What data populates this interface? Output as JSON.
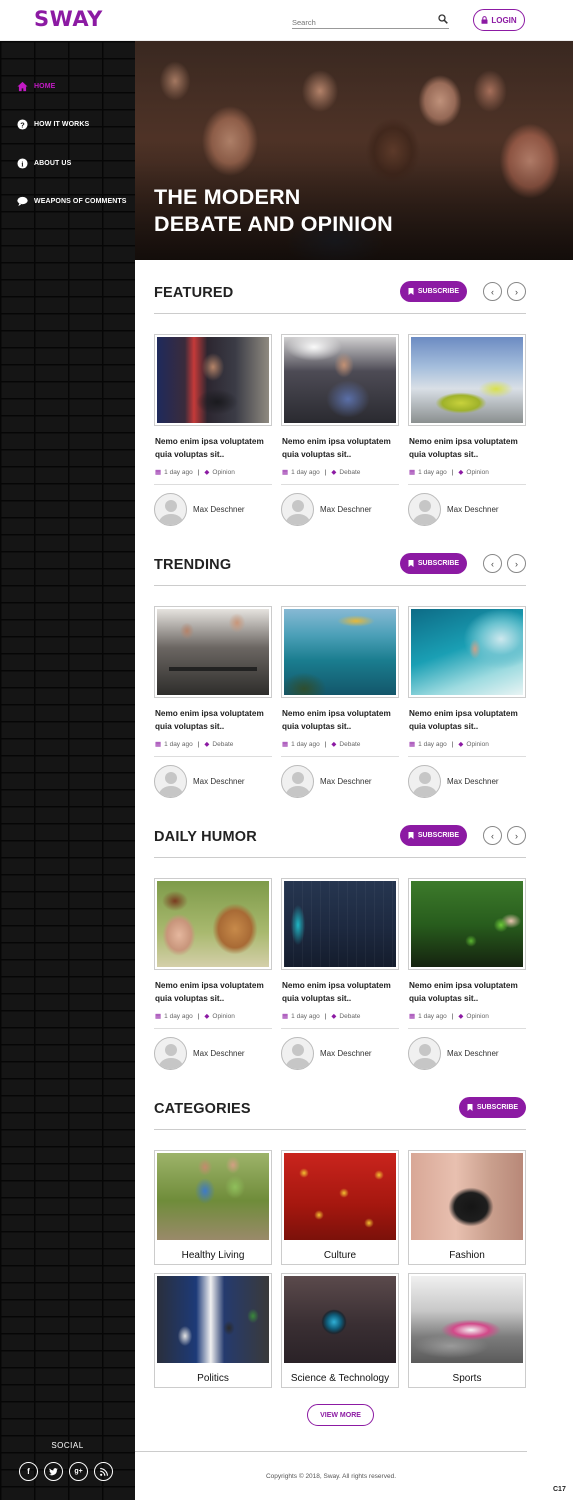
{
  "header": {
    "logo": "SWAY",
    "search_placeholder": "Search",
    "login_label": "LOGIN"
  },
  "sidebar": {
    "items": [
      {
        "label": "HOME",
        "icon": "home-icon"
      },
      {
        "label": "HOW IT WORKS",
        "icon": "question-circle-icon"
      },
      {
        "label": "ABOUT US",
        "icon": "info-circle-icon"
      },
      {
        "label": "WEAPONS OF COMMENTS",
        "icon": "comment-icon"
      }
    ],
    "social_title": "SOCIAL",
    "social": [
      "facebook-icon",
      "twitter-icon",
      "google-plus-icon",
      "rss-icon"
    ]
  },
  "hero": {
    "title_line1": "THE MODERN",
    "title_line2": "DEBATE AND OPINION"
  },
  "sections": [
    {
      "title": "FEATURED",
      "subscribe": "SUBSCRIBE",
      "cards": [
        {
          "title_line1": "Nemo enim ipsa voluptatem",
          "title_line2": "quia voluptas sit..",
          "time": "1 day ago",
          "tag": "Opinion",
          "author": "Max Deschner"
        },
        {
          "title_line1": "Nemo enim ipsa voluptatem",
          "title_line2": "quia voluptas sit..",
          "time": "1 day ago",
          "tag": "Debate",
          "author": "Max Deschner"
        },
        {
          "title_line1": "Nemo enim ipsa voluptatem",
          "title_line2": "quia voluptas sit..",
          "time": "1 day ago",
          "tag": "Opinion",
          "author": "Max Deschner"
        }
      ]
    },
    {
      "title": "TRENDING",
      "subscribe": "SUBSCRIBE",
      "cards": [
        {
          "title_line1": "Nemo enim ipsa voluptatem",
          "title_line2": "quia voluptas sit..",
          "time": "1 day ago",
          "tag": "Debate",
          "author": "Max Deschner"
        },
        {
          "title_line1": "Nemo enim ipsa voluptatem",
          "title_line2": "quia voluptas sit..",
          "time": "1 day ago",
          "tag": "Debate",
          "author": "Max Deschner"
        },
        {
          "title_line1": "Nemo enim ipsa voluptatem",
          "title_line2": "quia voluptas sit..",
          "time": "1 day ago",
          "tag": "Opinion",
          "author": "Max Deschner"
        }
      ]
    },
    {
      "title": "DAILY HUMOR",
      "subscribe": "SUBSCRIBE",
      "cards": [
        {
          "title_line1": "Nemo enim ipsa voluptatem",
          "title_line2": "quia voluptas sit..",
          "time": "1 day ago",
          "tag": "Opinion",
          "author": "Max Deschner"
        },
        {
          "title_line1": "Nemo enim ipsa voluptatem",
          "title_line2": "quia voluptas sit..",
          "time": "1 day ago",
          "tag": "Debate",
          "author": "Max Deschner"
        },
        {
          "title_line1": "Nemo enim ipsa voluptatem",
          "title_line2": "quia voluptas sit..",
          "time": "1 day ago",
          "tag": "Opinion",
          "author": "Max Deschner"
        }
      ]
    }
  ],
  "categories": {
    "title": "CATEGORIES",
    "subscribe": "SUBSCRIBE",
    "items": [
      "Healthy Living",
      "Culture",
      "Fashion",
      "Politics",
      "Science & Technology",
      "Sports"
    ]
  },
  "view_more": "VIEW MORE",
  "copyright": "Copyrights © 2018, Sway. All rights reserved.",
  "corner_label": "C17",
  "colors": {
    "accent": "#8c1aa3",
    "active_nav": "#c21ac4",
    "sidebar_bg": "#151515"
  }
}
